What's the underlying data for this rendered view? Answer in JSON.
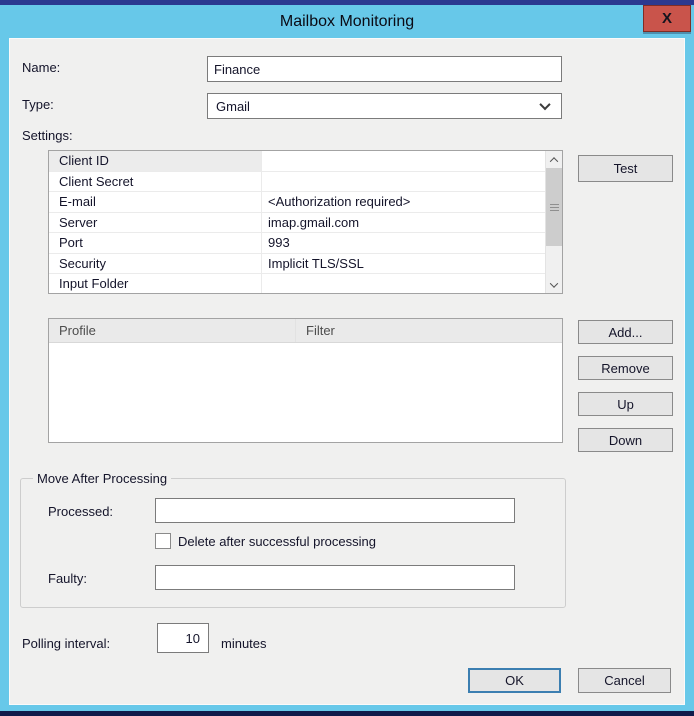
{
  "window": {
    "title": "Mailbox Monitoring",
    "close_label": "X"
  },
  "colors": {
    "titlebar_blue": "#67C8E9",
    "top_strip_navy": "#2B3990",
    "bottom_strip_navy": "#111A4A",
    "close_red": "#C9544B",
    "dialog_gray": "#F0F0EF",
    "default_button_accent": "#3C7FB1"
  },
  "fields": {
    "name": {
      "label": "Name:",
      "value": "Finance"
    },
    "type": {
      "label": "Type:",
      "value": "Gmail"
    }
  },
  "settings": {
    "label": "Settings:",
    "selected_index": 0,
    "rows": [
      {
        "key": "Client ID",
        "value": ""
      },
      {
        "key": "Client Secret",
        "value": ""
      },
      {
        "key": "E-mail",
        "value": "<Authorization required>"
      },
      {
        "key": "Server",
        "value": "imap.gmail.com"
      },
      {
        "key": "Port",
        "value": "993"
      },
      {
        "key": "Security",
        "value": "Implicit TLS/SSL"
      },
      {
        "key": "Input Folder",
        "value": ""
      }
    ],
    "test_button": "Test"
  },
  "profiles": {
    "columns": [
      "Profile",
      "Filter"
    ],
    "rows": [],
    "buttons": {
      "add": "Add...",
      "remove": "Remove",
      "up": "Up",
      "down": "Down"
    }
  },
  "move_after_processing": {
    "title": "Move After Processing",
    "processed_label": "Processed:",
    "processed_value": "",
    "delete_checkbox_label": "Delete after successful processing",
    "delete_checked": false,
    "faulty_label": "Faulty:",
    "faulty_value": ""
  },
  "polling": {
    "label": "Polling interval:",
    "value": "10",
    "unit": "minutes"
  },
  "actions": {
    "ok": "OK",
    "cancel": "Cancel"
  }
}
